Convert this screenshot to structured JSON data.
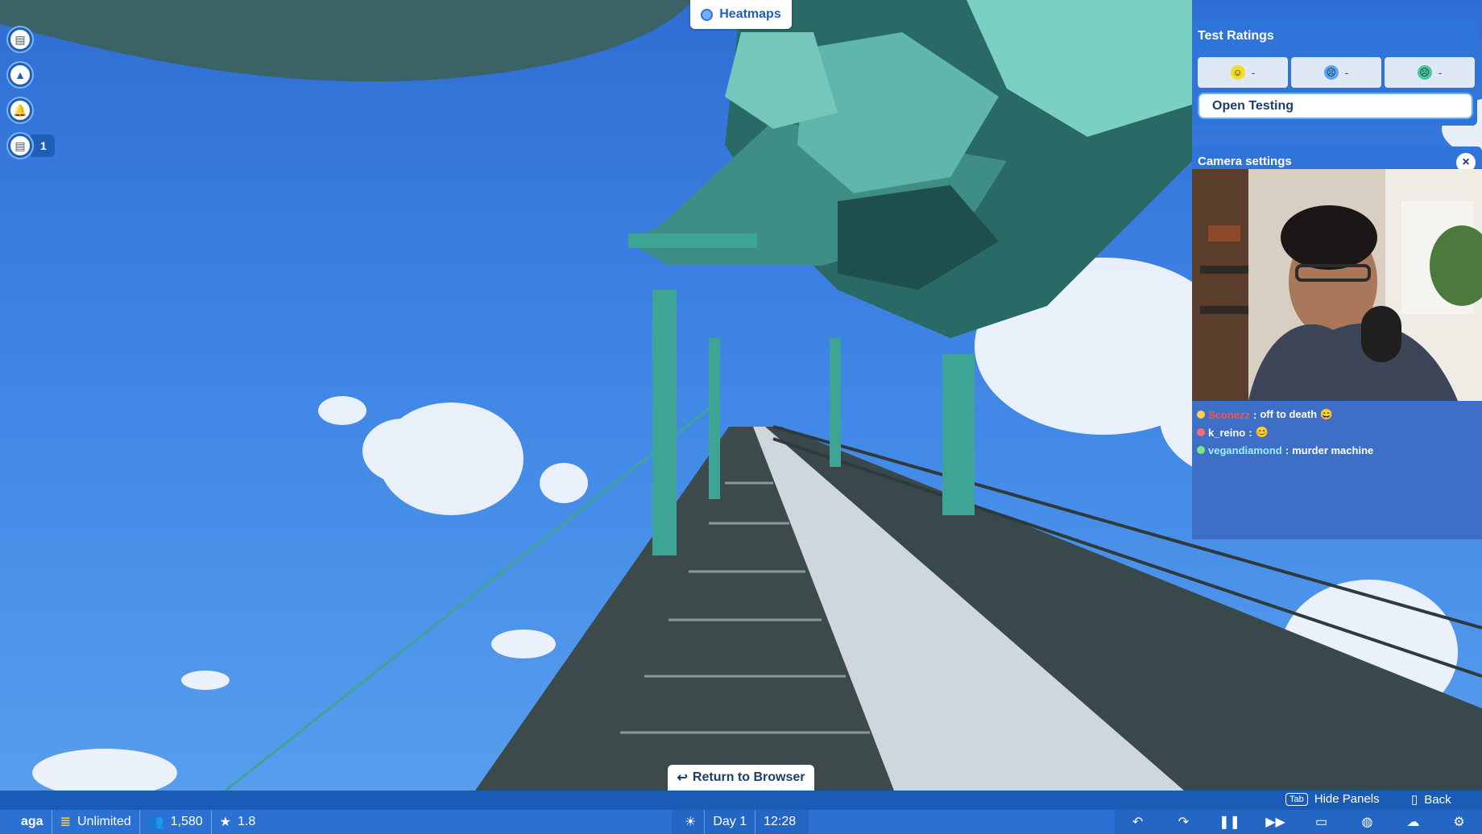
{
  "heatmaps": {
    "label": "Heatmaps"
  },
  "left_toolbar": {
    "tasks_count": "1"
  },
  "test_ratings": {
    "title": "Test Ratings",
    "ratings": [
      {
        "value": "-",
        "face": "happy",
        "color": "#f3dc2a"
      },
      {
        "value": "-",
        "face": "sad",
        "color": "#5aa6f0"
      },
      {
        "value": "-",
        "face": "sick",
        "color": "#4cc89a"
      }
    ],
    "open_label": "Open Testing"
  },
  "camera_settings": {
    "title": "Camera settings",
    "close": "×"
  },
  "chat": [
    {
      "user": "Sconezz",
      "msg": "off to death 😄",
      "color": "#ff4f4f"
    },
    {
      "user": "k_reino",
      "msg": "😊",
      "color": "#ffffff"
    },
    {
      "user": "vegandiamond",
      "msg": "murder machine",
      "color": "#9bf0ff"
    }
  ],
  "return_browser": {
    "label": "Return to Browser"
  },
  "hints": {
    "tab_key": "Tab",
    "hide_panels": "Hide Panels",
    "back": "Back"
  },
  "status": {
    "player": "aga",
    "money": "Unlimited",
    "guests": "1,580",
    "rating": "1.8",
    "day": "Day 1",
    "time": "12:28"
  },
  "colors": {
    "sky": "#3f86e6",
    "structure": "#3aa89a",
    "panel": "#2f74d9"
  }
}
